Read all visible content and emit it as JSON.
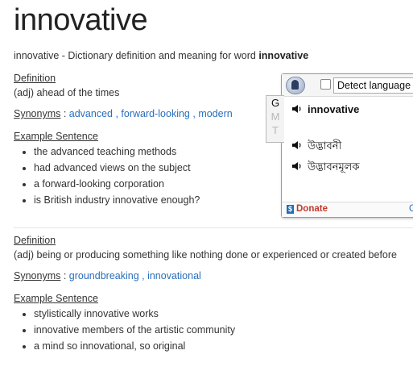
{
  "word": "innovative",
  "subtitle": {
    "prefix": "innovative - Dictionary definition and meaning for word ",
    "bold": "innovative"
  },
  "entries": [
    {
      "definition_label": "Definition",
      "definition": "(adj) ahead of the times",
      "synonyms_label": "Synonyms",
      "synonyms": [
        "advanced",
        "forward-looking",
        "modern"
      ],
      "examples_label": "Example Sentence",
      "examples": [
        "the advanced teaching methods",
        "had advanced views on the subject",
        "a forward-looking corporation",
        "is British industry innovative enough?"
      ]
    },
    {
      "definition_label": "Definition",
      "definition": "(adj) being or producing something like nothing done or experienced or created before",
      "synonyms_label": "Synonyms",
      "synonyms": [
        "groundbreaking",
        "innovational"
      ],
      "examples_label": "Example Sentence",
      "examples": [
        "stylistically innovative works",
        "innovative members of the artistic community",
        "a mind so innovational, so original"
      ]
    }
  ],
  "popup": {
    "detect_language": "Detect language",
    "gmt_tabs": [
      "G",
      "M",
      "T"
    ],
    "source_word": "innovative",
    "translations": [
      "উদ্ভাবনী",
      "উদ্ভাবনমূলক"
    ],
    "donate_icon": "$",
    "donate": "Donate",
    "corner_link": "C"
  },
  "colors": {
    "link": "#2a6ebb",
    "donate": "#c0392b"
  }
}
